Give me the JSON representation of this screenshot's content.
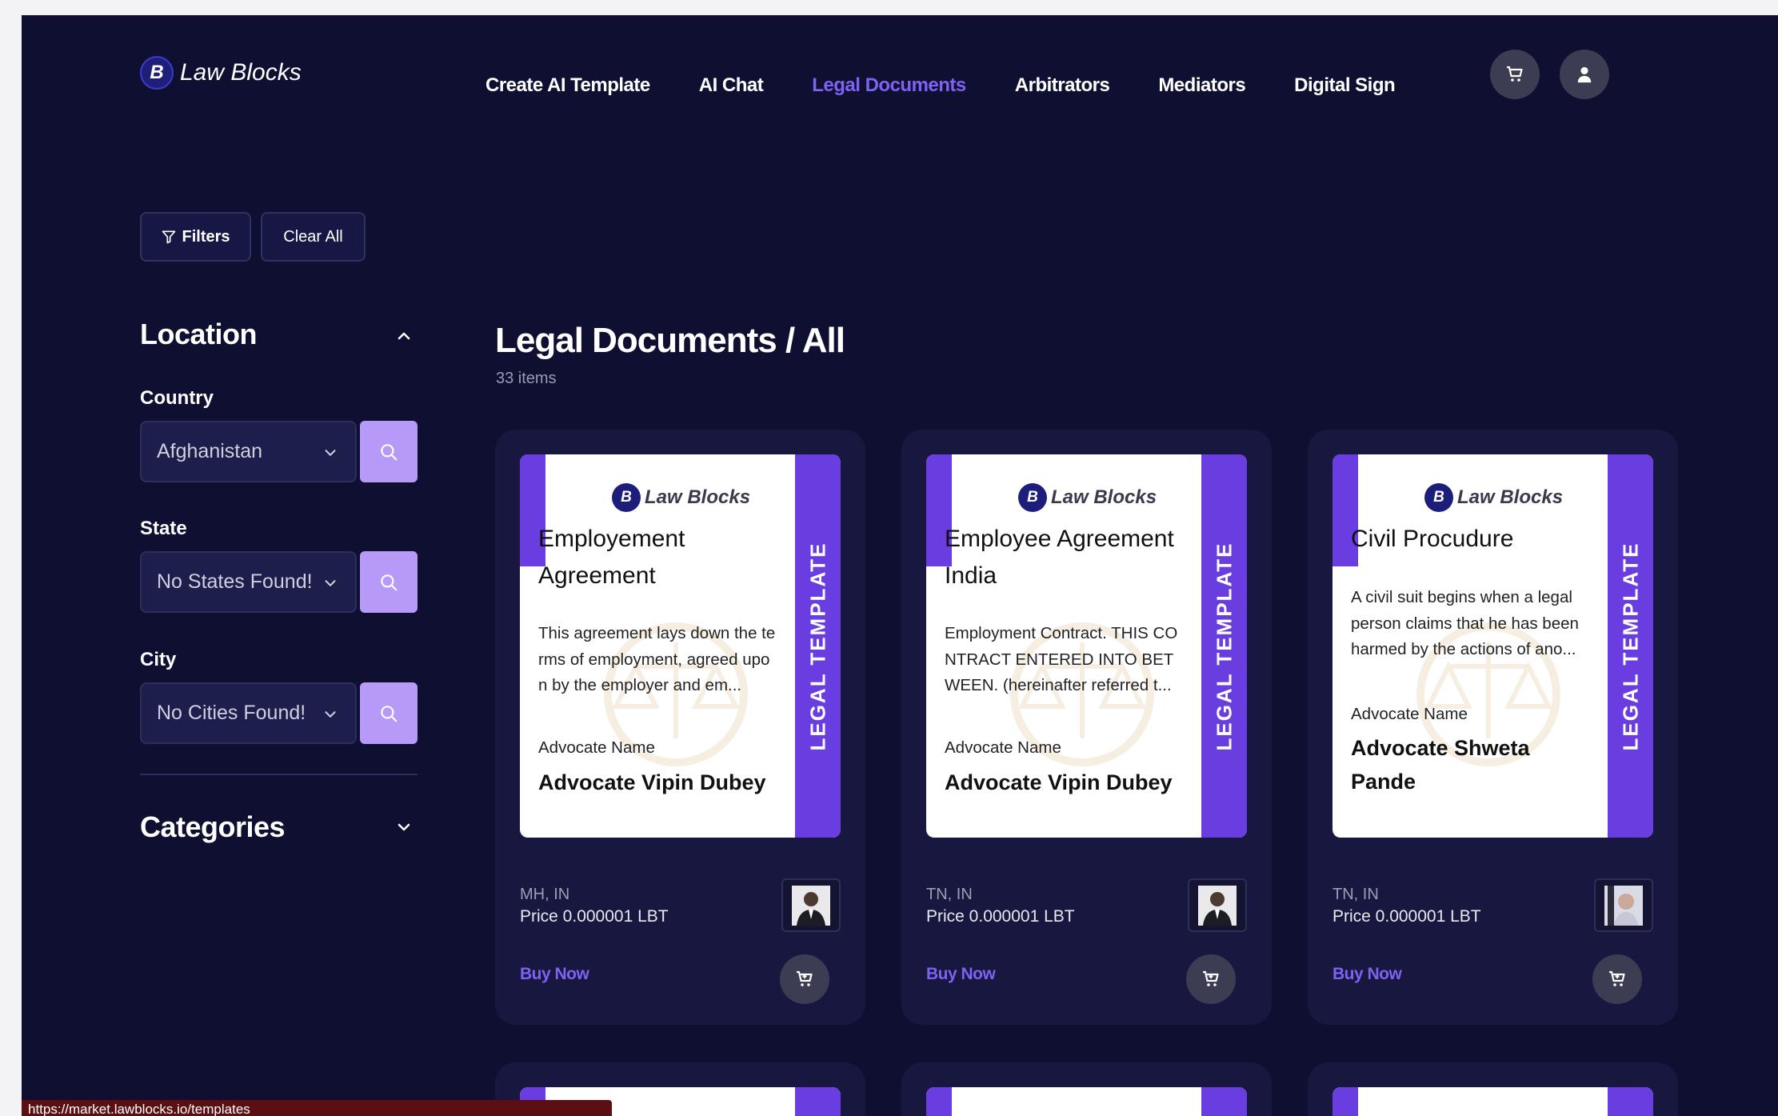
{
  "app": {
    "name": "Law Blocks",
    "logo_letter": "B"
  },
  "nav": {
    "items": [
      {
        "label": "Create AI Template",
        "active": false
      },
      {
        "label": "AI Chat",
        "active": false
      },
      {
        "label": "Legal Documents",
        "active": true
      },
      {
        "label": "Arbitrators",
        "active": false
      },
      {
        "label": "Mediators",
        "active": false
      },
      {
        "label": "Digital Sign",
        "active": false
      }
    ],
    "icons": [
      "cart-icon",
      "user-icon"
    ]
  },
  "filters": {
    "filters_label": "Filters",
    "clear_label": "Clear All"
  },
  "sidebar": {
    "location_title": "Location",
    "country_label": "Country",
    "country_value": "Afghanistan",
    "state_label": "State",
    "state_value": "No States Found!",
    "city_label": "City",
    "city_value": "No Cities Found!",
    "categories_title": "Categories"
  },
  "main": {
    "title": "Legal Documents / All",
    "count": "33 items"
  },
  "cards": [
    {
      "brand": "Law Blocks",
      "doc_title": "Employement Agreement",
      "description": "This agreement lays down the terms of employment, agreed upon by the employer and em...",
      "advocate_label": "Advocate Name",
      "advocate": "Advocate Vipin Dubey",
      "band_text": "LEGAL TEMPLATE",
      "location": "MH, IN",
      "price": "Price 0.000001 LBT",
      "buy": "Buy Now"
    },
    {
      "brand": "Law Blocks",
      "doc_title": "Employee Agreement India",
      "description": "Employment Contract. THIS CONTRACT ENTERED INTO BETWEEN. (hereinafter referred t...",
      "advocate_label": "Advocate Name",
      "advocate": "Advocate Vipin Dubey",
      "band_text": "LEGAL TEMPLATE",
      "location": "TN, IN",
      "price": "Price 0.000001 LBT",
      "buy": "Buy Now"
    },
    {
      "brand": "Law Blocks",
      "doc_title": "Civil Procudure",
      "description": "A civil suit begins when a legal person claims that he has been harmed by the actions of ano...",
      "advocate_label": "Advocate Name",
      "advocate": "Advocate Shweta Pande",
      "band_text": "LEGAL TEMPLATE",
      "location": "TN, IN",
      "price": "Price 0.000001 LBT",
      "buy": "Buy Now"
    }
  ],
  "status_bar": {
    "url": "https://market.lawblocks.io/templates"
  },
  "colors": {
    "background": "#0f0f31",
    "accent": "#7e62f2",
    "card": "#17173f",
    "band": "#6a3de0",
    "search_button": "#b79af8"
  }
}
